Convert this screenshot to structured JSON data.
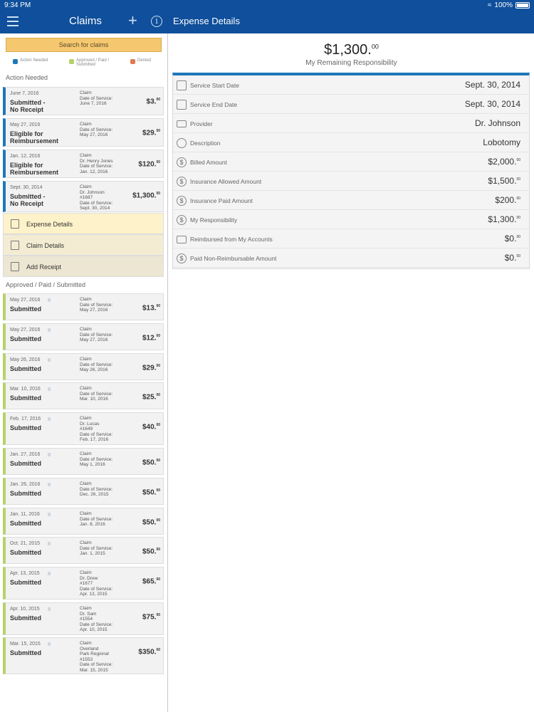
{
  "status_bar": {
    "time": "9:34 PM",
    "battery": "100%"
  },
  "header": {
    "left_title": "Claims",
    "plus_symbol": "+",
    "info_symbol": "i",
    "right_title": "Expense Details"
  },
  "search": {
    "label": "Search for claims"
  },
  "legend": [
    {
      "label": "Action Needed",
      "color": "#1f77b9"
    },
    {
      "label": "Approved / Paid /\nSubmitted",
      "color": "#b5d26a"
    },
    {
      "label": "Denied",
      "color": "#e07a4f"
    }
  ],
  "sections": {
    "action_needed": "Action Needed",
    "approved": "Approved / Paid / Submitted"
  },
  "action_claims": [
    {
      "date": "June 7, 2016",
      "status": "Submitted -\nNo Receipt",
      "desc": "Claim\nDate of Service:\nJune 7, 2016",
      "amount": "$3.",
      "cents": "00"
    },
    {
      "date": "May 27, 2016",
      "status": "Eligible for\nReimbursement",
      "desc": "Claim\nDate of Service:\nMay 27, 2016",
      "amount": "$29.",
      "cents": "00"
    },
    {
      "date": "Jan. 12, 2016",
      "status": "Eligible for\nReimbursement",
      "desc": "Claim\nDr. Henry Jones\nDate of Service:\nJan. 12, 2016",
      "amount": "$120.",
      "cents": "00"
    },
    {
      "date": "Sept. 30, 2014",
      "status": "Submitted -\nNo Receipt",
      "desc": "Claim\nDr. Johnson\n#1687\nDate of Service:\nSept. 30, 2014",
      "amount": "$1,300.",
      "cents": "00"
    }
  ],
  "sub_actions": [
    {
      "label": "Expense Details"
    },
    {
      "label": "Claim Details"
    },
    {
      "label": "Add Receipt"
    }
  ],
  "approved_claims": [
    {
      "date": "May 27, 2016",
      "status": "Submitted",
      "desc": "Claim\nDate of Service:\nMay 27, 2016",
      "amount": "$13.",
      "cents": "00"
    },
    {
      "date": "May 27, 2016",
      "status": "Submitted",
      "desc": "Claim\nDate of Service:\nMay 27, 2016",
      "amount": "$12.",
      "cents": "00"
    },
    {
      "date": "May 26, 2016",
      "status": "Submitted",
      "desc": "Claim\nDate of Service:\nMay 26, 2016",
      "amount": "$29.",
      "cents": "00"
    },
    {
      "date": "Mar. 10, 2016",
      "status": "Submitted",
      "desc": "Claim\nDate of Service:\nMar. 10, 2016",
      "amount": "$25.",
      "cents": "00"
    },
    {
      "date": "Feb. 17, 2016",
      "status": "Submitted",
      "desc": "Claim\nDr. Lucas\n#1649\nDate of Service:\nFeb. 17, 2016",
      "amount": "$40.",
      "cents": "00"
    },
    {
      "date": "Jan. 27, 2016",
      "status": "Submitted",
      "desc": "Claim\nDate of Service:\nMay 1, 2016",
      "amount": "$50.",
      "cents": "00"
    },
    {
      "date": "Jan. 26, 2016",
      "status": "Submitted",
      "desc": "Claim\nDate of Service:\nDec. 26, 2015",
      "amount": "$50.",
      "cents": "00"
    },
    {
      "date": "Jan. 11, 2016",
      "status": "Submitted",
      "desc": "Claim\nDate of Service:\nJan. 8, 2016",
      "amount": "$50.",
      "cents": "00"
    },
    {
      "date": "Oct. 21, 2015",
      "status": "Submitted",
      "desc": "Claim\nDate of Service:\nJan. 1, 2015",
      "amount": "$50.",
      "cents": "00"
    },
    {
      "date": "Apr. 13, 2015",
      "status": "Submitted",
      "desc": "Claim\nDr. Drew\n#1677\nDate of Service:\nApr. 13, 2015",
      "amount": "$65.",
      "cents": "00"
    },
    {
      "date": "Apr. 10, 2015",
      "status": "Submitted",
      "desc": "Claim\nDr. Sam\n#1554\nDate of Service:\nApr. 10, 2015",
      "amount": "$75.",
      "cents": "00"
    },
    {
      "date": "Mar. 15, 2015",
      "status": "Submitted",
      "desc": "Claim\nOverland\nPark Regional\n#1553\nDate of Service:\nMar. 15, 2015",
      "amount": "$350.",
      "cents": "00"
    }
  ],
  "expense": {
    "amount": "$1,300.",
    "cents": "00",
    "label": "My Remaining Responsibility",
    "rows": [
      {
        "label": "Service Start Date",
        "value": "Sept. 30, 2014",
        "cents": "",
        "icon": "calendar-icon"
      },
      {
        "label": "Service End Date",
        "value": "Sept. 30, 2014",
        "cents": "",
        "icon": "calendar-icon"
      },
      {
        "label": "Provider",
        "value": "Dr. Johnson",
        "cents": "",
        "icon": "id-card-icon"
      },
      {
        "label": "Description",
        "value": "Lobotomy",
        "cents": "",
        "icon": "speech-bubble-icon"
      },
      {
        "label": "Billed Amount",
        "value": "$2,000.",
        "cents": "00",
        "icon": "dollar-icon"
      },
      {
        "label": "Insurance Allowed Amount",
        "value": "$1,500.",
        "cents": "00",
        "icon": "dollar-icon"
      },
      {
        "label": "Insurance Paid Amount",
        "value": "$200.",
        "cents": "00",
        "icon": "dollar-icon"
      },
      {
        "label": "My Responsibility",
        "value": "$1,300.",
        "cents": "00",
        "icon": "dollar-icon"
      },
      {
        "label": "Reimbursed from My Accounts",
        "value": "$0.",
        "cents": "00",
        "icon": "briefcase-icon"
      },
      {
        "label": "Paid Non-Reimbursable Amount",
        "value": "$0.",
        "cents": "00",
        "icon": "dollar-icon"
      }
    ]
  }
}
